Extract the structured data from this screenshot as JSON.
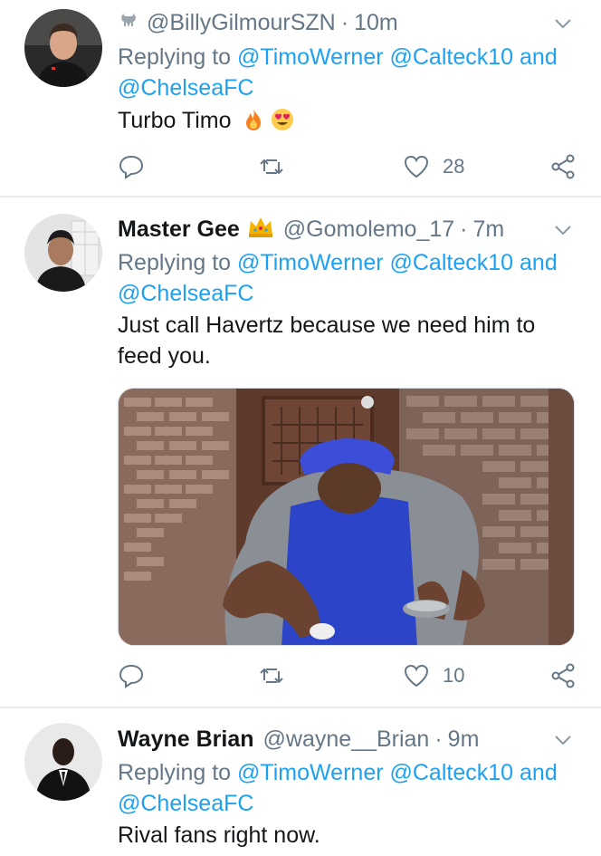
{
  "tweets": [
    {
      "display_name": "",
      "handle": "@BillyGilmourSZN",
      "time": "10m",
      "replying_prefix": "Replying to",
      "mention_1": "@TimoWerner",
      "mention_2": "@Calteck10",
      "and_word": "and",
      "mention_3": "@ChelseaFC",
      "text": "Turbo Timo",
      "badge_icon": "goat-icon",
      "emojis": [
        "fire-icon",
        "heart-eyes-icon"
      ],
      "actions": {
        "reply": "",
        "retweet": "",
        "likes": "28",
        "share": ""
      }
    },
    {
      "display_name": "Master Gee",
      "handle": "@Gomolemo_17",
      "time": "7m",
      "replying_prefix": "Replying to",
      "mention_1": "@TimoWerner",
      "mention_2": "@Calteck10",
      "and_word": "and",
      "mention_3": "@ChelseaFC",
      "text": "Just call Havertz because we need him to feed you.",
      "badge_icon": "crown-icon",
      "media": "photo",
      "actions": {
        "reply": "",
        "retweet": "",
        "likes": "10",
        "share": ""
      }
    },
    {
      "display_name": "Wayne Brian",
      "handle": "@wayne__Brian",
      "time": "9m",
      "replying_prefix": "Replying to",
      "mention_1": "@TimoWerner",
      "mention_2": "@Calteck10",
      "and_word": "and",
      "mention_3": "@ChelseaFC",
      "text": "Rival fans right now."
    }
  ],
  "colors": {
    "link": "#1da1f2",
    "secondary": "#657786",
    "primary": "#14171a",
    "divider": "#e6ecf0"
  }
}
